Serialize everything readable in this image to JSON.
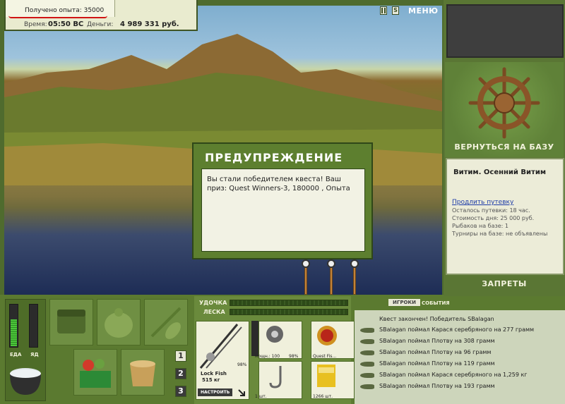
{
  "info": {
    "exp_text": "Получено опыта: 35000",
    "time_label": "Время:",
    "time_value": "05:50 ВС",
    "money_label": "Деньги:",
    "money_value": "4 989 331 руб."
  },
  "top_controls": {
    "pause_icon": "pause-icon",
    "sound_label": "S",
    "menu_label": "МЕНЮ"
  },
  "right_panel": {
    "return_label": "ВЕРНУТЬСЯ НА БАЗУ",
    "base_name": "Витим. Осенний Витим",
    "extend_link": "Продлить путевку",
    "lines": [
      "Осталось путевки: 18 час.",
      "Стоимость дня: 25 000 руб.",
      "Рыбаков на базе: 1",
      "Турниры на базе: не объявлены"
    ],
    "bans_label": "ЗАПРЕТЫ"
  },
  "dialog": {
    "title": "ПРЕДУПРЕЖДЕНИЕ",
    "message": "Вы стали победителем квеста! Ваш приз: Quest Winners-3, 180000 , Опыта"
  },
  "status": {
    "food_label": "ЕДА",
    "poison_label": "ЯД",
    "food_level": 0.65,
    "poison_level": 0.0
  },
  "pages": [
    "1",
    "2",
    "3"
  ],
  "rod_panel": {
    "rod_label": "УДОЧКА",
    "line_label": "ЛЕСКА",
    "rod_name": "Lock Fish",
    "rod_weight": "515 кг",
    "rod_percent": "98%",
    "reel_power": "мощн.: 100",
    "reel_percent": "98%",
    "bait_name": "Quest Fis...",
    "hook_count": "1 шт.",
    "groundbait_count": "1266 шт.",
    "setup_label": "НАСТРОИТЬ"
  },
  "log": {
    "tab_players": "ИГРОКИ",
    "tab_events": "СОБЫТИЯ",
    "header": "Квест закончен! Победитель SBalagan",
    "entries": [
      "SBalagan поймал Карася серебряного на 277 грамм",
      "SBalagan поймал Плотву на 308 грамм",
      "SBalagan поймал Плотву на 96 грамм",
      "SBalagan поймал Плотву на 119 грамм",
      "SBalagan поймал Карася серебряного на 1,259 кг",
      "SBalagan поймал Плотву на 193 грамм"
    ]
  }
}
